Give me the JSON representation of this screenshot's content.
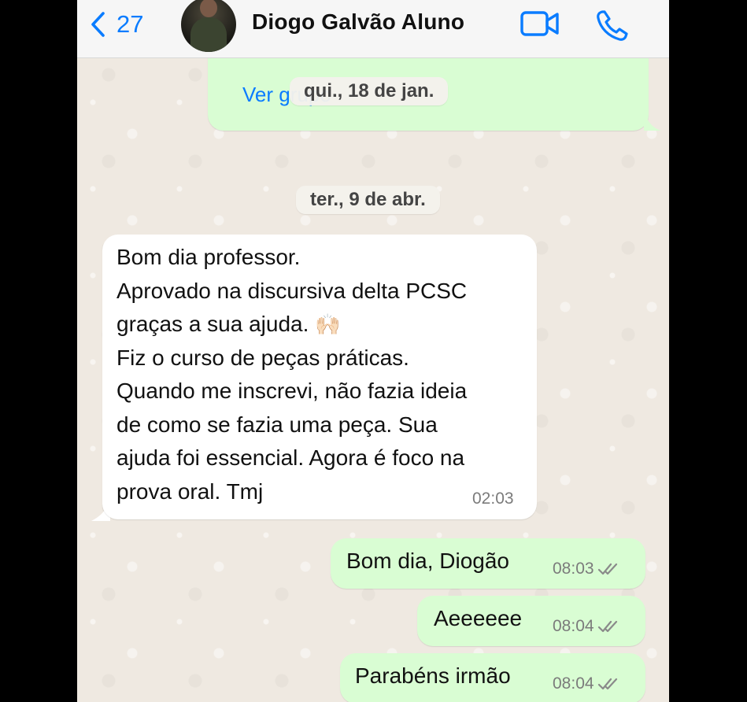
{
  "header": {
    "back_count": "27",
    "contact_name": "Diogo Galvão Aluno"
  },
  "colors": {
    "accent": "#0a7cff",
    "outgoing_bubble": "#d9fdd3",
    "incoming_bubble": "#ffffff",
    "chat_background": "#efeae2"
  },
  "icons": {
    "back": "chevron-left-icon",
    "video": "video-camera-icon",
    "call": "phone-icon",
    "read_status": "double-check-icon",
    "emoji": "raised-hands-emoji"
  },
  "chat": {
    "prev_bubble": {
      "link_label": "Ver grupo"
    },
    "date_1": "qui., 18 de jan.",
    "date_2": "ter., 9 de abr.",
    "messages": [
      {
        "direction": "in",
        "text_before_emoji": "Bom dia professor.\nAprovado na discursiva delta PCSC\ngraças a sua ajuda. ",
        "emoji": "🙌🏻",
        "text_after_emoji": "\nFiz o curso de peças práticas.\nQuando me inscrevi, não fazia ideia\nde como se fazia uma peça. Sua\najuda foi essencial. Agora é foco na\nprova oral. Tmj",
        "time": "02:03"
      },
      {
        "direction": "out",
        "text": "Bom dia, Diogão",
        "time": "08:03"
      },
      {
        "direction": "out",
        "text": "Aeeeeee",
        "time": "08:04"
      },
      {
        "direction": "out",
        "text": "Parabéns irmão",
        "time": "08:04"
      }
    ]
  }
}
